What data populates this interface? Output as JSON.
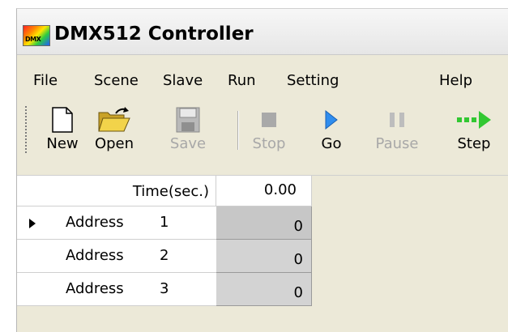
{
  "window": {
    "title": "DMX512 Controller",
    "icon": "dmx-app-icon",
    "icon_text": "DMX"
  },
  "menu": [
    {
      "label": "File"
    },
    {
      "label": "Scene"
    },
    {
      "label": "Slave"
    },
    {
      "label": "Run"
    },
    {
      "label": "Setting"
    },
    {
      "label": "Help"
    }
  ],
  "toolbar": {
    "new": {
      "label": "New",
      "icon": "new-document-icon",
      "enabled": true
    },
    "open": {
      "label": "Open",
      "icon": "open-folder-icon",
      "enabled": true
    },
    "save": {
      "label": "Save",
      "icon": "save-disk-icon",
      "enabled": false
    },
    "stop": {
      "label": "Stop",
      "icon": "stop-icon",
      "enabled": false
    },
    "go": {
      "label": "Go",
      "icon": "play-icon",
      "enabled": true
    },
    "pause": {
      "label": "Pause",
      "icon": "pause-icon",
      "enabled": false
    },
    "step": {
      "label": "Step",
      "icon": "step-forward-icon",
      "enabled": true
    }
  },
  "grid": {
    "time_header": "Time(sec.)",
    "time_value": "0.00",
    "rows": [
      {
        "label": "Address",
        "num": "1",
        "value": "0",
        "current": true
      },
      {
        "label": "Address",
        "num": "2",
        "value": "0",
        "current": false
      },
      {
        "label": "Address",
        "num": "3",
        "value": "0",
        "current": false
      }
    ]
  }
}
